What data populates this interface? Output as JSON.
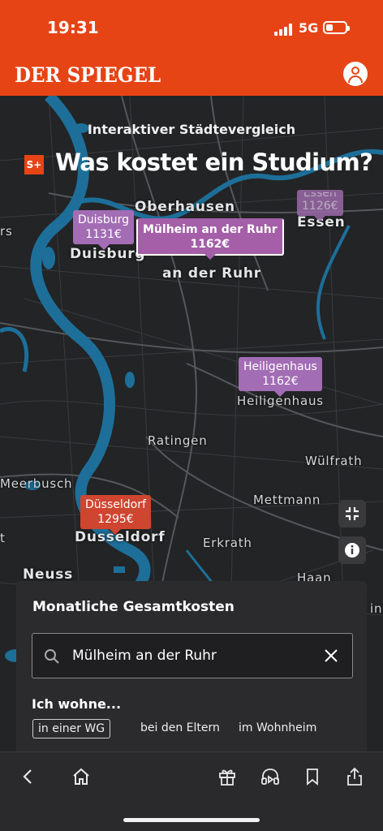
{
  "status": {
    "time": "19:31",
    "network": "5G"
  },
  "header": {
    "logo": "DER SPIEGEL",
    "account_icon": "user-circle-icon"
  },
  "article": {
    "subtitle": "Interaktiver Städtevergleich",
    "badge": "S+",
    "title": "Was kostet ein Studium?"
  },
  "map": {
    "places": {
      "oberhausen": "Oberhausen",
      "essen": "Essen",
      "duisburg": "Duisburg",
      "muelheim_line2": "an der Ruhr",
      "edge_left": "rs",
      "heiligenhaus": "Heiligenhaus",
      "ratingen": "Ratingen",
      "wuelfrath": "Wülfrath",
      "meerbusch": "Meerbusch",
      "mettmann": "Mettmann",
      "duesseldorf": "Dusseldorf",
      "erkrath": "Erkrath",
      "neuss": "Neuss",
      "haan": "Haan",
      "edge_t": "t",
      "edge_right": "in"
    },
    "markers": {
      "duisburg": {
        "city": "Duisburg",
        "cost": "1131€"
      },
      "muelheim": {
        "city": "Mülheim an der Ruhr",
        "cost": "1162€"
      },
      "essen": {
        "city": "Essen",
        "cost": "1126€"
      },
      "heiligenhaus": {
        "city": "Heiligenhaus",
        "cost": "1162€"
      },
      "duesseldorf": {
        "city": "Düsseldorf",
        "cost": "1295€"
      }
    },
    "controls": {
      "fullscreen_icon": "collapse-icon",
      "info_icon": "info-icon"
    }
  },
  "panel": {
    "title": "Monatliche Gesamtkosten",
    "search_value": "Mülheim an der Ruhr",
    "living_label": "Ich wohne...",
    "options": [
      "in einer WG",
      "bei den Eltern",
      "im Wohnheim"
    ],
    "selected_option": "in einer WG"
  },
  "browser_bar": {
    "icons": [
      "back-icon",
      "home-icon",
      "gift-icon",
      "audio-icon",
      "bookmark-icon",
      "share-icon"
    ]
  },
  "colors": {
    "brand": "#e64415",
    "marker_purple": "#a26db4",
    "marker_red": "#cf4530",
    "water": "#1d6f99"
  }
}
